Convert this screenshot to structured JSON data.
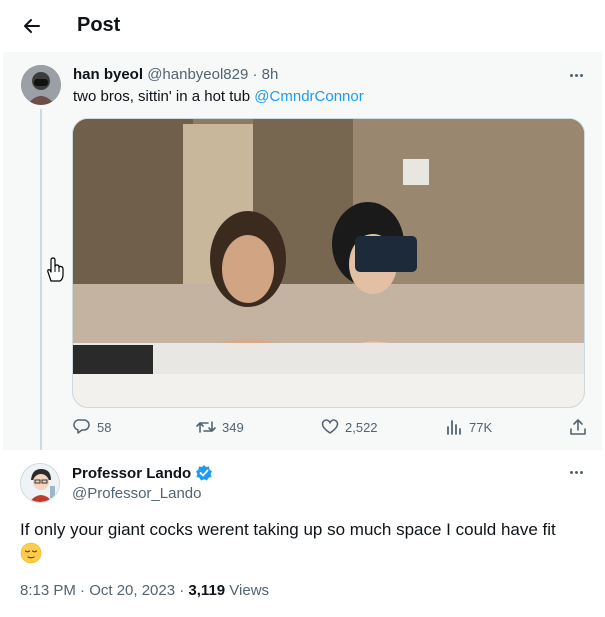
{
  "header": {
    "title": "Post"
  },
  "parent_post": {
    "author_name": "han byeol",
    "author_handle": "@hanbyeol829",
    "separator": "·",
    "time": "8h",
    "text": "two bros, sittin' in a hot tub ",
    "mention": "@CmndrConnor",
    "media_icon": "photo",
    "stats": {
      "replies": "58",
      "reposts": "349",
      "likes": "2,522",
      "views": "77K"
    }
  },
  "reply": {
    "author_name": "Professor Lando",
    "verified": true,
    "author_handle": "@Professor_Lando",
    "text": "If only your giant cocks werent taking up so much space I could have fit",
    "emoji": "relieved-face",
    "timestamp": "8:13 PM · Oct 20, 2023 · ",
    "views_count": "3,119",
    "views_label": " Views"
  },
  "colors": {
    "accent": "#1d9bf0",
    "text_primary": "#0f1419",
    "text_secondary": "#536471",
    "highlight_bg": "#f7f9f9"
  }
}
